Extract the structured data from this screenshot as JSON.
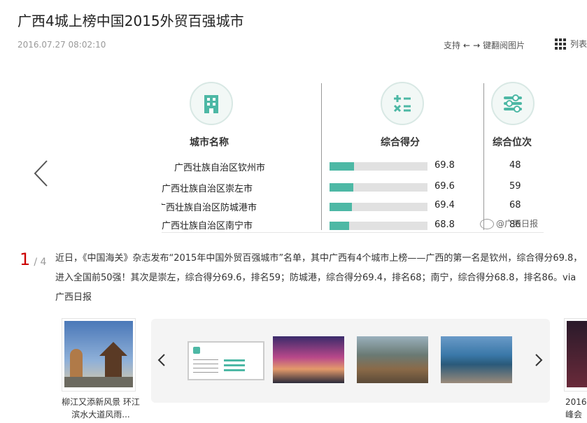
{
  "header": {
    "title": "广西4城上榜中国2015外贸百强城市",
    "date": "2016.07.27 08:02:10",
    "support_label": "支持",
    "flip_label": "键翻阅图片",
    "list_label": "列表"
  },
  "image": {
    "col_city": "城市名称",
    "col_score": "综合得分",
    "col_rank": "综合位次",
    "rows": [
      {
        "city": "广西壮族自治区钦州市",
        "score": "69.8",
        "rank": "48",
        "bar": 0.25
      },
      {
        "city": "广西壮族自治区崇左市",
        "score": "69.6",
        "rank": "59",
        "bar": 0.24
      },
      {
        "city": "广西壮族自治区防城港市",
        "score": "69.4",
        "rank": "68",
        "bar": 0.23
      },
      {
        "city": "广西壮族自治区南宁市",
        "score": "68.8",
        "rank": "86",
        "bar": 0.2
      }
    ],
    "watermark": "@广西日报",
    "bar_color": "#4db8a5"
  },
  "counter": {
    "current": "1",
    "total": "/ 4"
  },
  "description": "近日，《中国海关》杂志发布“2015年中国外贸百强城市”名单，其中广西有4个城市上榜——广西的第一名是钦州，综合得分69.8，进入全国前50强！其次是崇左，综合得分69.6，排名59；防城港，综合得分69.4，排名68；南宁，综合得分68.8，排名86。via广西日报",
  "related_left": {
    "caption": "柳江又添新风景 环江滨水大道风雨..."
  },
  "related_right": {
    "caption": "2016 峰会"
  },
  "icons": [
    "prev-arrow-icon",
    "next-arrow-icon",
    "grid-list-icon",
    "left-arrow-icon",
    "right-arrow-icon",
    "building-icon",
    "calculator-icon",
    "sliders-icon",
    "weibo-icon"
  ]
}
